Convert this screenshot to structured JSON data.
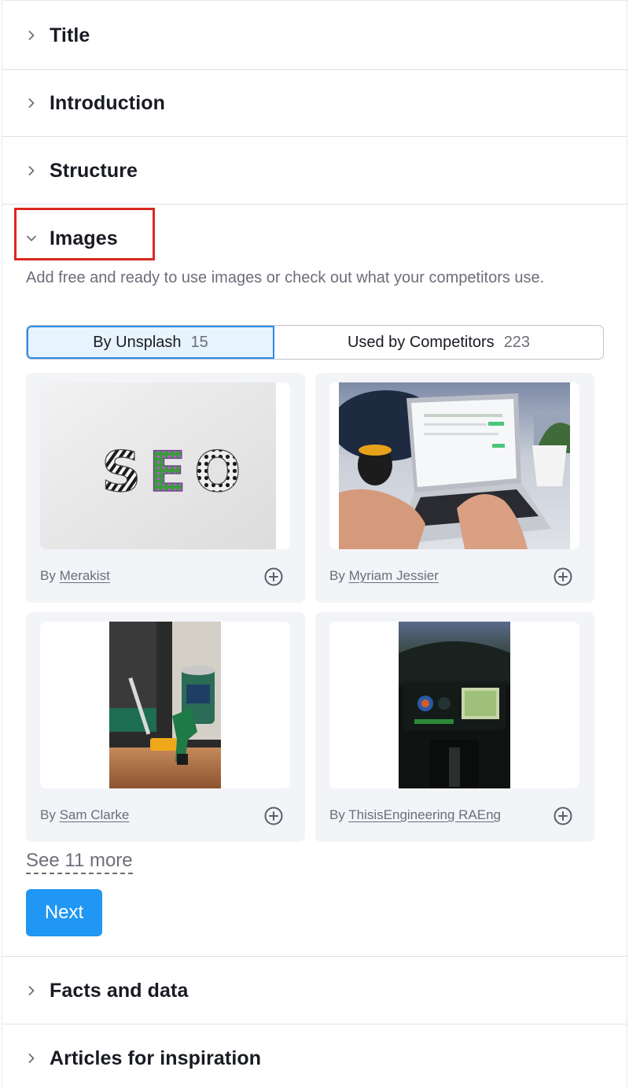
{
  "sections": {
    "title": "Title",
    "introduction": "Introduction",
    "structure": "Structure",
    "images": "Images",
    "facts": "Facts and data",
    "articles": "Articles for inspiration"
  },
  "images_panel": {
    "description": "Add free and ready to use images or check out what your competitors use.",
    "tabs": [
      {
        "label": "By Unsplash",
        "count": "15",
        "active": true
      },
      {
        "label": "Used by Competitors",
        "count": "223",
        "active": false
      }
    ],
    "by_prefix": "By",
    "cards": [
      {
        "author": "Merakist",
        "image": "seo-letters-photo"
      },
      {
        "author": "Myriam Jessier",
        "image": "laptop-typing-photo"
      },
      {
        "author": "Sam Clarke",
        "image": "tools-drill-photo"
      },
      {
        "author": "ThisisEngineering RAEng",
        "image": "cockpit-photo"
      }
    ],
    "see_more": "See 11 more",
    "next_button": "Next"
  },
  "icons": {
    "collapsed": "chevron-right-icon",
    "expanded": "chevron-down-icon",
    "add": "plus-circle-icon"
  },
  "colors": {
    "accent": "#1f97f3",
    "tab_active_bg": "#e7f3fe",
    "tab_active_border": "#2e89e6",
    "highlight": "#d9281f",
    "card_bg": "#f3f4f8"
  }
}
